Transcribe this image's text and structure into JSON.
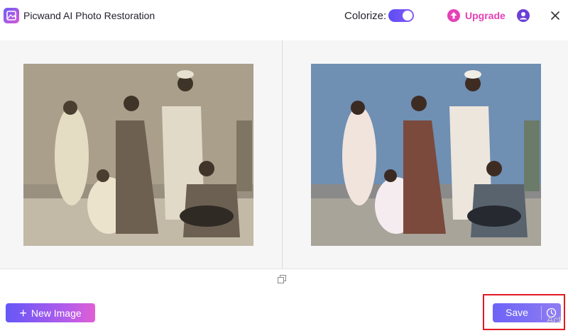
{
  "app": {
    "title": "Picwand AI Photo Restoration",
    "logo_icon": "photo-restoration-logo-icon"
  },
  "header": {
    "colorize_label": "Colorize:",
    "colorize_on": true,
    "upgrade_label": "Upgrade",
    "accent_color": "#e641b6",
    "toggle_color": "#5b4cf5",
    "user_icon": "user-account-icon",
    "close_icon": "close-icon"
  },
  "compare": {
    "original_image_alt": "Original black-and-white photograph of seven people",
    "colorized_image_alt": "Colorized version of the photograph",
    "compare_icon": "copy-compare-icon"
  },
  "footer": {
    "new_image_label": "New Image",
    "new_image_icon": "plus-icon",
    "save_label": "Save",
    "history_icon": "history-clock-icon",
    "watermark": "Act"
  },
  "colors": {
    "primary": "#6557f7",
    "highlight_border": "#e01b24"
  }
}
